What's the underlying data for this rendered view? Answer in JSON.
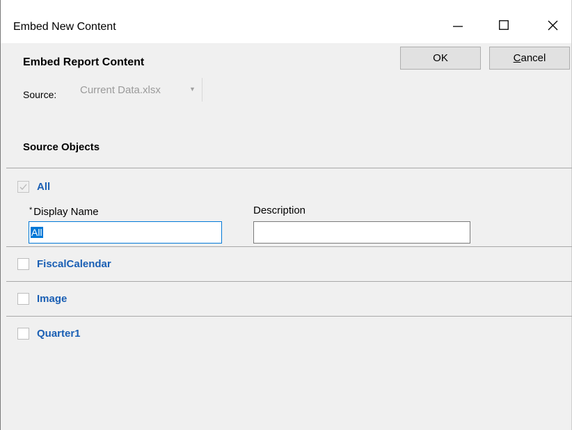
{
  "window": {
    "title": "Embed New Content",
    "controls": {
      "minimize": "minimize",
      "maximize": "maximize",
      "close": "close"
    }
  },
  "header": {
    "heading": "Embed Report Content",
    "ok_label": "OK",
    "cancel_label": "Cancel",
    "cancel_accel": "C",
    "cancel_rest": "ancel"
  },
  "source": {
    "label": "Source:",
    "value": "Current Data.xlsx",
    "enabled": false
  },
  "objects": {
    "heading": "Source Objects",
    "items": [
      {
        "label": "All",
        "checked": true,
        "disabled": true,
        "expanded": true,
        "display_name_label": "Display Name",
        "required_marker": "*",
        "display_name_value": "All",
        "description_label": "Description",
        "description_value": ""
      },
      {
        "label": "FiscalCalendar",
        "checked": false
      },
      {
        "label": "Image",
        "checked": false
      },
      {
        "label": "Quarter1",
        "checked": false
      }
    ]
  },
  "colors": {
    "accent": "#0078d7",
    "object_label": "#1a5fb4",
    "dialog_bg": "#f0f0f0"
  },
  "icons": [
    "minimize-icon",
    "maximize-icon",
    "close-icon",
    "dropdown-arrow-icon",
    "checkmark-icon"
  ]
}
